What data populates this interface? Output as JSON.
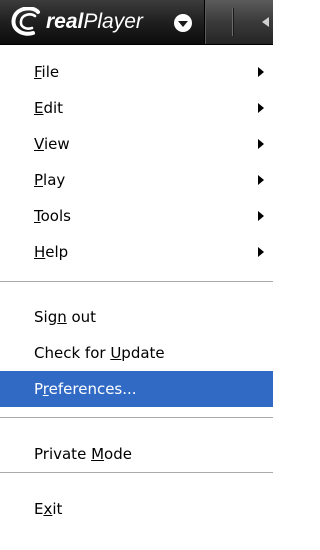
{
  "app": {
    "logo_text_real": "real",
    "logo_text_player": "Player"
  },
  "menu": {
    "items": [
      {
        "id": "file",
        "label": "File",
        "mnemonic": "F",
        "submenu": true
      },
      {
        "id": "edit",
        "label": "Edit",
        "mnemonic": "E",
        "submenu": true
      },
      {
        "id": "view",
        "label": "View",
        "mnemonic": "V",
        "submenu": true
      },
      {
        "id": "play",
        "label": "Play",
        "mnemonic": "P",
        "submenu": true
      },
      {
        "id": "tools",
        "label": "Tools",
        "mnemonic": "T",
        "submenu": true
      },
      {
        "id": "help",
        "label": "Help",
        "mnemonic": "H",
        "submenu": true
      },
      {
        "id": "sign-out",
        "label": "Sign out",
        "mnemonic": "n"
      },
      {
        "id": "check-update",
        "label": "Check for Update",
        "mnemonic": "U"
      },
      {
        "id": "preferences",
        "label": "Preferences...",
        "mnemonic": "r",
        "selected": true
      },
      {
        "id": "private-mode",
        "label": "Private Mode",
        "mnemonic": "M"
      },
      {
        "id": "exit",
        "label": "Exit",
        "mnemonic": "x"
      }
    ]
  },
  "colors": {
    "selection_bg": "#316ac5",
    "selection_fg": "#ffffff",
    "separator": "#a9a9a9",
    "titlebar_dark": "#141414"
  },
  "icons": {
    "logo": "realplayer-logo-icon",
    "caret": "chevron-down-icon",
    "submenu": "submenu-arrow-icon",
    "back": "back-arrow-icon"
  }
}
